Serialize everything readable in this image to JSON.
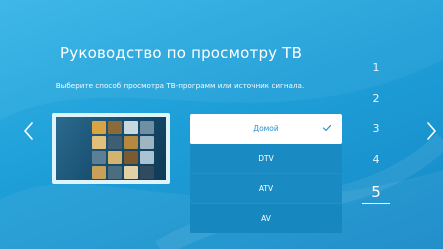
{
  "screen": {
    "title": "Руководство по просмотру ТВ",
    "subtitle": "Выберите способ просмотра ТВ-программ или источник сигнала."
  },
  "navigation": {
    "prev_icon": "chevron-left-icon",
    "next_icon": "chevron-right-icon"
  },
  "preview": {
    "image": "tv-program-thumbnail"
  },
  "source_options": [
    {
      "label": "Домой",
      "selected": true
    },
    {
      "label": "DTV",
      "selected": false
    },
    {
      "label": "ATV",
      "selected": false
    },
    {
      "label": "AV",
      "selected": false
    }
  ],
  "steps": {
    "items": [
      "1",
      "2",
      "3",
      "4",
      "5"
    ],
    "current": "5"
  },
  "colors": {
    "background": "#1e9fd8",
    "option_bg": "#1a8bc2",
    "selected_bg": "#ffffff",
    "selected_text": "#2a8fcf"
  }
}
